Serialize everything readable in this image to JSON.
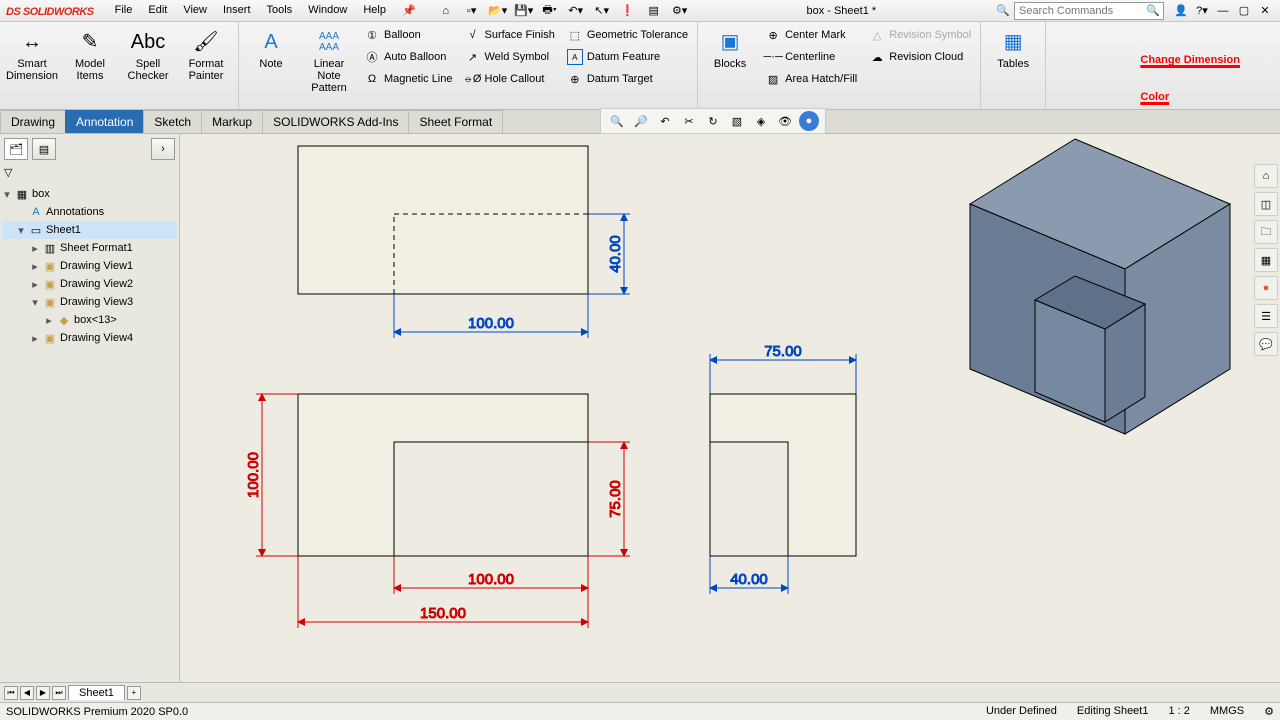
{
  "app_name": "SOLIDWORKS",
  "doc_title": "box - Sheet1 *",
  "menu": [
    "File",
    "Edit",
    "View",
    "Insert",
    "Tools",
    "Window",
    "Help"
  ],
  "search_placeholder": "Search Commands",
  "ribbon": {
    "smart_dim": "Smart Dimension",
    "model_items": "Model Items",
    "spell": "Spell Checker",
    "format": "Format Painter",
    "note": "Note",
    "linear_note": "Linear Note Pattern",
    "balloon": "Balloon",
    "auto_balloon": "Auto Balloon",
    "magnetic": "Magnetic Line",
    "surface": "Surface Finish",
    "weld": "Weld Symbol",
    "hole": "Hole Callout",
    "gtol": "Geometric Tolerance",
    "datum_feat": "Datum Feature",
    "datum_tgt": "Datum Target",
    "blocks": "Blocks",
    "center_mark": "Center Mark",
    "centerline": "Centerline",
    "area_hatch": "Area Hatch/Fill",
    "rev_symbol": "Revision Symbol",
    "rev_cloud": "Revision Cloud",
    "tables": "Tables"
  },
  "tabs": [
    "Drawing",
    "Annotation",
    "Sketch",
    "Markup",
    "SOLIDWORKS Add-Ins",
    "Sheet Format"
  ],
  "active_tab": "Annotation",
  "tree": {
    "root": "box",
    "annotations": "Annotations",
    "sheet": "Sheet1",
    "sheet_format": "Sheet Format1",
    "views": [
      "Drawing View1",
      "Drawing View2",
      "Drawing View3",
      "Drawing View4"
    ],
    "sub_part": "box<13>"
  },
  "overlay": {
    "line1": "Change Dimension",
    "line2": "Color"
  },
  "dims": {
    "top_w": "100.00",
    "top_h": "40.00",
    "front_w": "150.00",
    "front_h": "100.00",
    "front_notch_w": "100.00",
    "front_notch_h": "75.00",
    "side_w": "75.00",
    "side_notch_w": "40.00"
  },
  "sheet_tab": "Sheet1",
  "status": {
    "product": "SOLIDWORKS Premium 2020 SP0.0",
    "state": "Under Defined",
    "editing": "Editing Sheet1",
    "scale": "1 : 2",
    "units": "MMGS"
  }
}
